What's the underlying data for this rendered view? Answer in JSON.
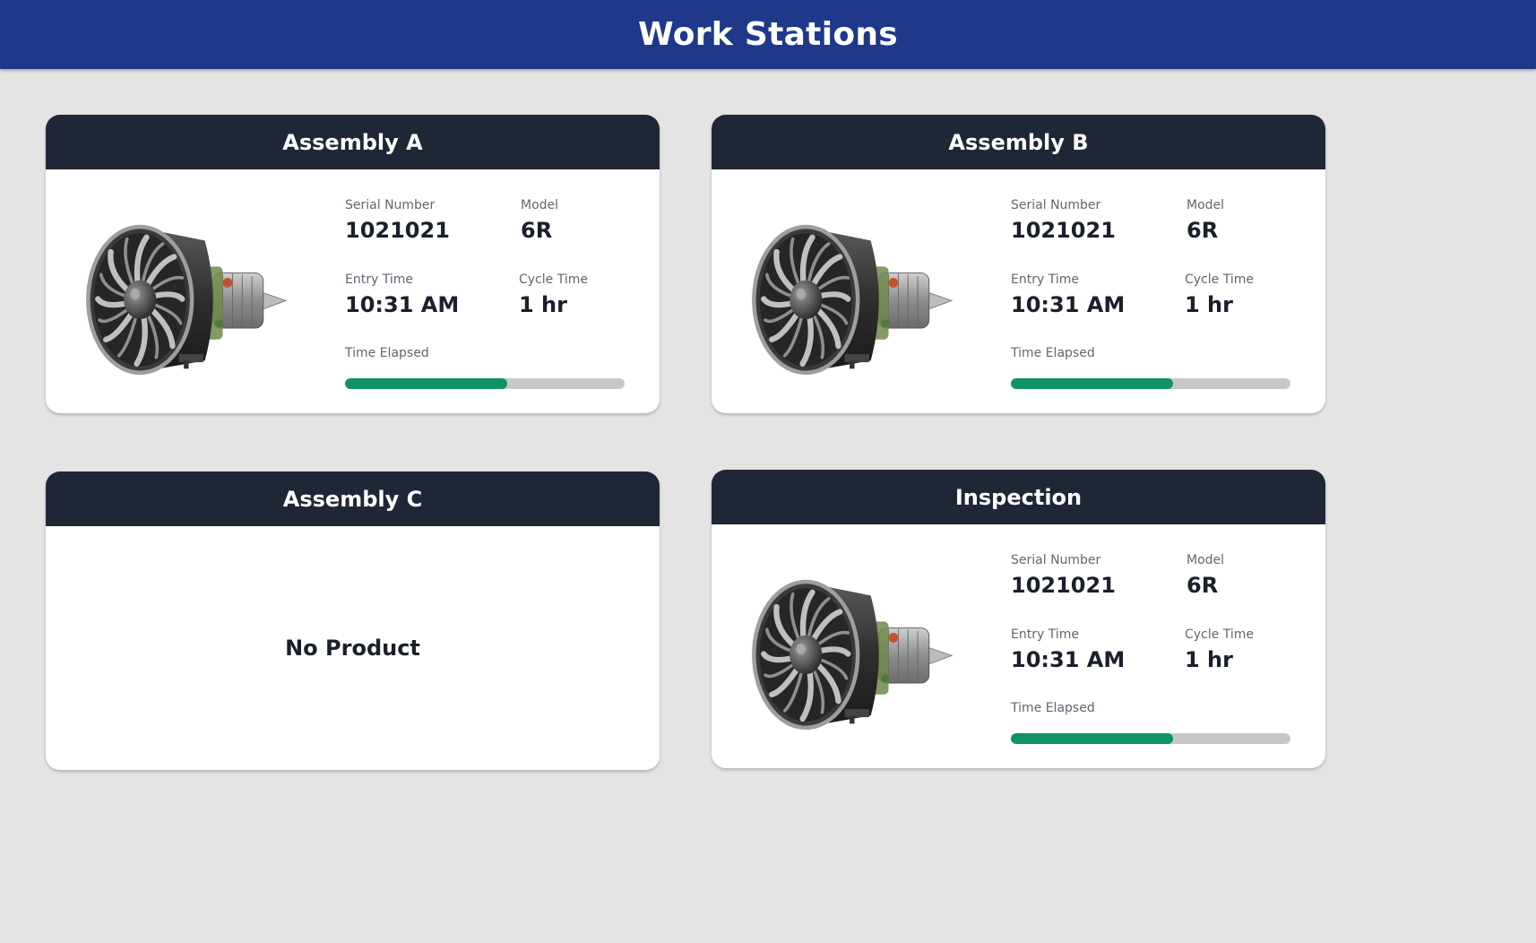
{
  "header": {
    "title": "Work Stations"
  },
  "labels": {
    "serial": "Serial Number",
    "model": "Model",
    "entry": "Entry Time",
    "cycle": "Cycle Time",
    "elapsed": "Time Elapsed"
  },
  "colors": {
    "topbar": "#1e398a",
    "card_header": "#1f2737",
    "progress_fill": "#0e9365",
    "progress_track": "#c8c8c8",
    "background": "#e4e4e4"
  },
  "stations": [
    {
      "name": "Assembly A",
      "serial": "1021021",
      "model": "6R",
      "entry": "10:31 AM",
      "cycle": "1 hr",
      "progress": 0.58
    },
    {
      "name": "Assembly B",
      "serial": "1021021",
      "model": "6R",
      "entry": "10:31 AM",
      "cycle": "1 hr",
      "progress": 0.58
    },
    {
      "name": "Assembly C",
      "empty_message": "No Product"
    },
    {
      "name": "Inspection",
      "serial": "1021021",
      "model": "6R",
      "entry": "10:31 AM",
      "cycle": "1 hr",
      "progress": 0.58
    }
  ]
}
